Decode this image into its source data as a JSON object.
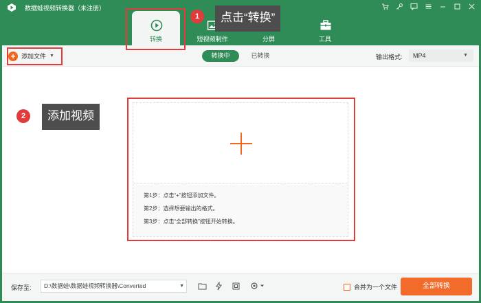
{
  "window": {
    "title": "数据蛙视频转换器（未注册）",
    "controls": [
      "cart-icon",
      "key-icon",
      "feedback-icon",
      "menu-icon",
      "minimize-icon",
      "maximize-icon",
      "close-icon"
    ]
  },
  "nav": {
    "tabs": [
      {
        "label": "转换",
        "icon": "convert-icon",
        "active": true
      },
      {
        "label": "短视频制作",
        "icon": "image-icon",
        "active": false
      },
      {
        "label": "分屏",
        "icon": "split-screen-icon",
        "active": false
      },
      {
        "label": "工具",
        "icon": "toolbox-icon",
        "active": false
      }
    ]
  },
  "annotations": {
    "step1": {
      "number": "1",
      "text": "点击“转换”"
    },
    "step2": {
      "number": "2",
      "text": "添加视频"
    },
    "highlight_color": "#e23b3b"
  },
  "toolbar": {
    "add_file_label": "添加文件",
    "segments": {
      "converting": "转换中",
      "converted": "已转换"
    },
    "output_format_label": "输出格式:",
    "output_format_value": "MP4"
  },
  "dropzone": {
    "steps": [
      "第1步：点击“+”按钮添加文件。",
      "第2步：选择想要输出的格式。",
      "第3步：点击“全部转换”按钮开始转换。"
    ]
  },
  "bottom": {
    "save_label": "保存至:",
    "save_path": "D:\\数据蛙\\数据蛙视频转换器\\Converted",
    "merge_label": "合并为一个文件",
    "convert_all_label": "全部转换"
  },
  "colors": {
    "brand_green": "#2f8c56",
    "accent_orange": "#f36b2a"
  }
}
